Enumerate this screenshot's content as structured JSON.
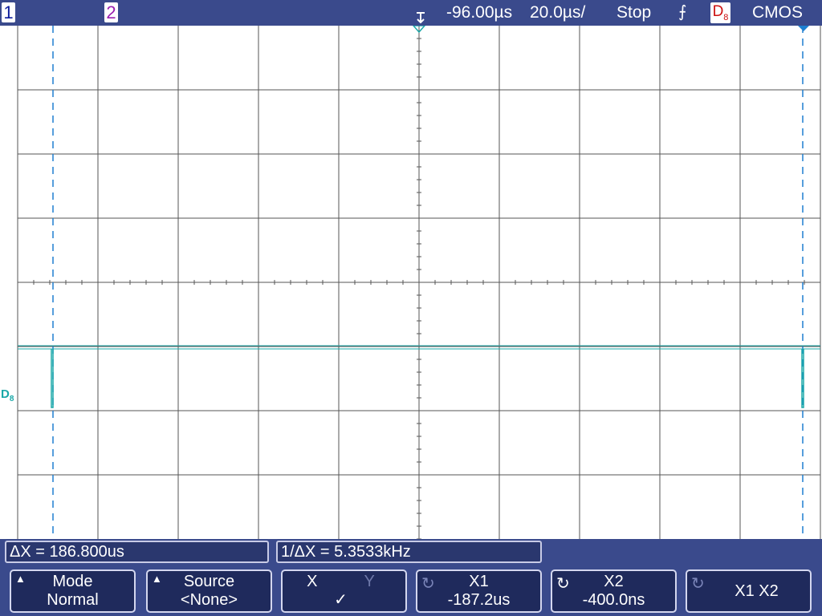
{
  "status_bar": {
    "channel1_label": "1",
    "channel2_label": "2",
    "delay": "-96.00µs",
    "timebase": "20.0µs/",
    "run_state": "Stop",
    "trigger_slope_icon": "falling-edge-icon",
    "trigger_source": "D",
    "trigger_source_sub": "8",
    "logic_threshold": "CMOS"
  },
  "waveform": {
    "channel_label": "D",
    "channel_label_sub": "8",
    "trace_color": "#1aa8a8",
    "grid_color": "#555555",
    "cursor_color": "#1e7fd0"
  },
  "measurements": {
    "delta_x": "ΔX = 186.800us",
    "inverse_delta_x": "1/ΔX = 5.3533kHz"
  },
  "softkeys": {
    "mode_label": "Mode",
    "mode_value": "Normal",
    "source_label": "Source",
    "source_value": "<None>",
    "x_label": "X",
    "y_label": "Y",
    "xy_check": "✓",
    "x1_label": "X1",
    "x1_value": "-187.2us",
    "x2_label": "X2",
    "x2_value": "-400.0ns",
    "x1x2_label": "X1 X2"
  },
  "colors": {
    "bar_background": "#3a4a8c",
    "softkey_background": "#1f2a5c"
  }
}
